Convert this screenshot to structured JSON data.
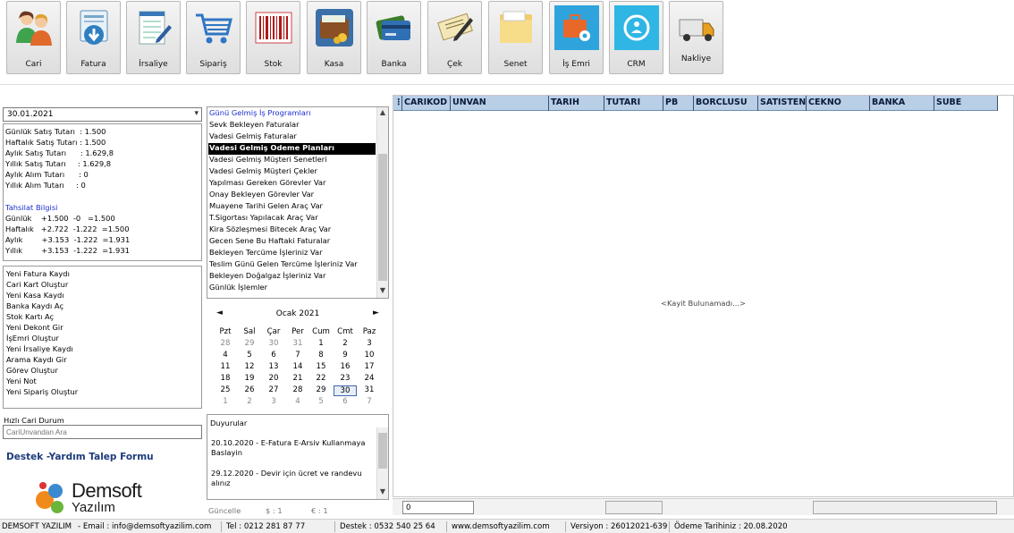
{
  "toolbar": {
    "buttons": [
      {
        "label": "Cari",
        "icon": "users-icon"
      },
      {
        "label": "Fatura",
        "icon": "invoice-download-icon"
      },
      {
        "label": "İrsaliye",
        "icon": "notepad-pencil-icon"
      },
      {
        "label": "Sipariş",
        "icon": "shopping-cart-icon"
      },
      {
        "label": "Stok",
        "icon": "barcode-icon"
      },
      {
        "label": "Kasa",
        "icon": "wallet-coins-icon"
      },
      {
        "label": "Banka",
        "icon": "bank-cards-icon"
      },
      {
        "label": "Çek",
        "icon": "check-note-icon"
      },
      {
        "label": "Senet",
        "icon": "folder-icon"
      },
      {
        "label": "İş Emri",
        "icon": "briefcase-gear-icon"
      },
      {
        "label": "CRM",
        "icon": "crm-circle-icon"
      },
      {
        "label": "Nakliye",
        "icon": "truck-icon"
      }
    ]
  },
  "left": {
    "date": "30.01.2021",
    "stats": [
      "Günlük Satış Tutarı  : 1.500",
      "Haftalık Satış Tutarı : 1.500",
      "Aylık Satış Tutarı      : 1.629,8",
      "Yıllık Satış Tutarı     : 1.629,8",
      "Aylık Alım Tutarı      : 0",
      "Yıllık Alım Tutarı     : 0"
    ],
    "tahsilat_heading": "Tahsilat Bilgisi",
    "tahsilat": [
      "Günlük    +1.500  -0   =1.500",
      "Haftalık   +2.722  -1.222  =1.500",
      "Aylık        +3.153  -1.222  =1.931",
      "Yıllık        +3.153  -1.222  =1.931"
    ],
    "quick_actions": [
      "Yeni Fatura Kaydı",
      "Cari Kart Oluştur",
      "Yeni Kasa Kaydı",
      "Banka Kaydı Aç",
      "Stok Kartı Aç",
      "Yeni Dekont Gir",
      "İşEmri Oluştur",
      "Yeni İrsaliye Kaydı",
      "Arama Kaydı Gir",
      "Görev Oluştur",
      "Yeni Not",
      "Yeni Sipariş Oluştur"
    ],
    "hizli_cari_label": "Hızlı Cari Durum",
    "hizli_cari_placeholder": "CariUnvandan Ara",
    "destek_link": "Destek -Yardım Talep Formu",
    "logo_line1": "Demsoft",
    "logo_line2": "Yazılım"
  },
  "middle": {
    "programs": [
      "Günü Gelmiş İş Programları",
      "Sevk Bekleyen Faturalar",
      "Vadesi Gelmiş Faturalar",
      "Vadesi Gelmiş Odeme Planları",
      "Vadesi Gelmiş Müşteri Senetleri",
      "Vadesi Gelmiş Müşteri Çekler",
      "Yapılması Gereken Görevler Var",
      "Onay Bekleyen Görevler Var",
      "Muayene Tarihi Gelen Araç Var",
      "T.Sigortası Yapılacak Araç Var",
      "Kira Sözleşmesi Bitecek Araç Var",
      "Gecen Sene Bu Haftaki Faturalar",
      "Bekleyen Tercüme İşleriniz Var",
      "Teslim Günü Gelen Tercüme İşleriniz Var",
      "Bekleyen Doğalgaz İşleriniz Var",
      "Günlük İşlemler"
    ],
    "selected_program": "Vadesi Gelmiş Odeme Planları",
    "calendar": {
      "title": "Ocak 2021",
      "prev": "◄",
      "next": "►",
      "weekdays": [
        "Pzt",
        "Sal",
        "Çar",
        "Per",
        "Cum",
        "Cmt",
        "Paz"
      ],
      "weeks": [
        [
          "28",
          "29",
          "30",
          "31",
          "1",
          "2",
          "3"
        ],
        [
          "4",
          "5",
          "6",
          "7",
          "8",
          "9",
          "10"
        ],
        [
          "11",
          "12",
          "13",
          "14",
          "15",
          "16",
          "17"
        ],
        [
          "18",
          "19",
          "20",
          "21",
          "22",
          "23",
          "24"
        ],
        [
          "25",
          "26",
          "27",
          "28",
          "29",
          "30",
          "31"
        ],
        [
          "1",
          "2",
          "3",
          "4",
          "5",
          "6",
          "7"
        ]
      ],
      "today": "30"
    },
    "duyurular": {
      "title": "Duyurular",
      "items": [
        "20.10.2020 - E-Fatura E-Arsiv Kullanmaya Baslayin",
        "29.12.2020 - Devir için ücret ve randevu alınız"
      ]
    },
    "guncelle": "Güncelle",
    "usd": "$ : 1",
    "eur": "€ : 1"
  },
  "grid": {
    "columns": [
      "CARIKOD",
      "UNVAN",
      "TARIH",
      "TUTARI",
      "PB",
      "BORCLUSU",
      "SATISTEN",
      "CEKNO",
      "BANKA",
      "SUBE"
    ],
    "empty_text": "<Kayit Bulunamadı...>",
    "row_count": "0"
  },
  "status": {
    "company": "DEMSOFT YAZILIM",
    "email": " - Email : info@demsoftyazilim.com",
    "tel": "Tel : 0212 281 87 77",
    "destek": "Destek : 0532 540 25 64",
    "web": "www.demsoftyazilim.com",
    "version": "Versiyon : 26012021-639",
    "payment": "Ödeme Tarihiniz : 20.08.2020"
  },
  "colors": {
    "grid_header": "#b8cfe6",
    "selection": "#000000",
    "link_blue": "#1a2fd0"
  }
}
